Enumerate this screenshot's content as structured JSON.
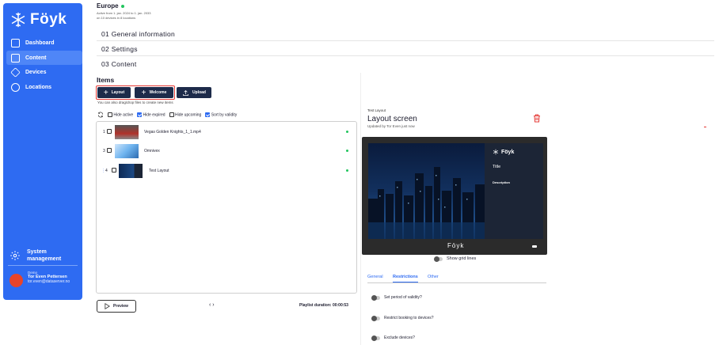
{
  "sidebar": {
    "logo_text": "Föyk",
    "items": [
      {
        "label": "Dashboard",
        "icon": "chart-icon"
      },
      {
        "label": "Content",
        "icon": "image-icon"
      },
      {
        "label": "Devices",
        "icon": "layers-icon"
      },
      {
        "label": "Locations",
        "icon": "location-icon"
      }
    ],
    "active_item": "Content",
    "system_line1": "System",
    "system_line2": "management",
    "user_org": "Demo",
    "user_name": "Tor Even Pettersen",
    "user_email": "tor.even@dataserver.no"
  },
  "header": {
    "title": "Europe",
    "status_color": "#22c55e",
    "active_range": "Active from 1. jan. 2024 to 1. jan. 2033",
    "devices_info": "on 10 devices in 8 locations"
  },
  "sections": [
    "01 General information",
    "02 Settings",
    "03 Content"
  ],
  "items": {
    "heading": "Items",
    "buttons": {
      "layout": "Layout",
      "welcome": "Welcome",
      "upload": "Upload"
    },
    "hint": "You can also drag/drop files to create new items",
    "filters": [
      {
        "label": "Hide active",
        "checked": false
      },
      {
        "label": "Hide expired",
        "checked": true
      },
      {
        "label": "Hide upcoming",
        "checked": false
      },
      {
        "label": "Sort by validity",
        "checked": true
      }
    ],
    "rows": [
      {
        "num": "1",
        "name": "Vegas Golden Knights_1_1.mp4"
      },
      {
        "num": "3",
        "name": "Omnivex"
      },
      {
        "num": "4",
        "name": "Test Layout"
      }
    ]
  },
  "footer": {
    "preview": "Preview",
    "pager": "‹ ›",
    "duration": "Playlist duration: 00:00:53"
  },
  "right_panel": {
    "small_label": "Test Layout",
    "title": "Layout screen",
    "updated": "Updated by Tor Even just now",
    "preview_logo": "Föyk",
    "preview_title": "Title",
    "preview_description": "Description",
    "preview_footer": "Föyk",
    "grid_label": "Show grid lines",
    "tabs": [
      "General",
      "Restrictions",
      "Other"
    ],
    "active_tab": "Restrictions",
    "options": [
      "Set period of validity?",
      "Restrict booking to devices?",
      "Exclude devices?"
    ]
  },
  "colors": {
    "brand": "#2e6bf2",
    "button_dark": "#1d2b4a",
    "highlight": "#e53935"
  }
}
